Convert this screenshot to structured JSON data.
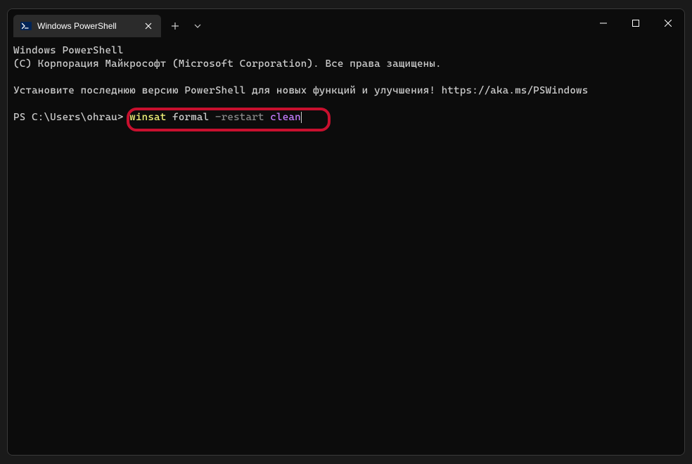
{
  "tab": {
    "title": "Windows PowerShell"
  },
  "terminal": {
    "line1": "Windows PowerShell",
    "line2": "(C) Корпорация Майкрософт (Microsoft Corporation). Все права защищены.",
    "line3": "Установите последнюю версию PowerShell для новых функций и улучшения! https://aka.ms/PSWindows",
    "prompt": "PS C:\\Users\\ohrau> ",
    "cmd_w1": "winsat",
    "cmd_w2": "formal",
    "cmd_w3": "-restart",
    "cmd_w4": "clean"
  }
}
